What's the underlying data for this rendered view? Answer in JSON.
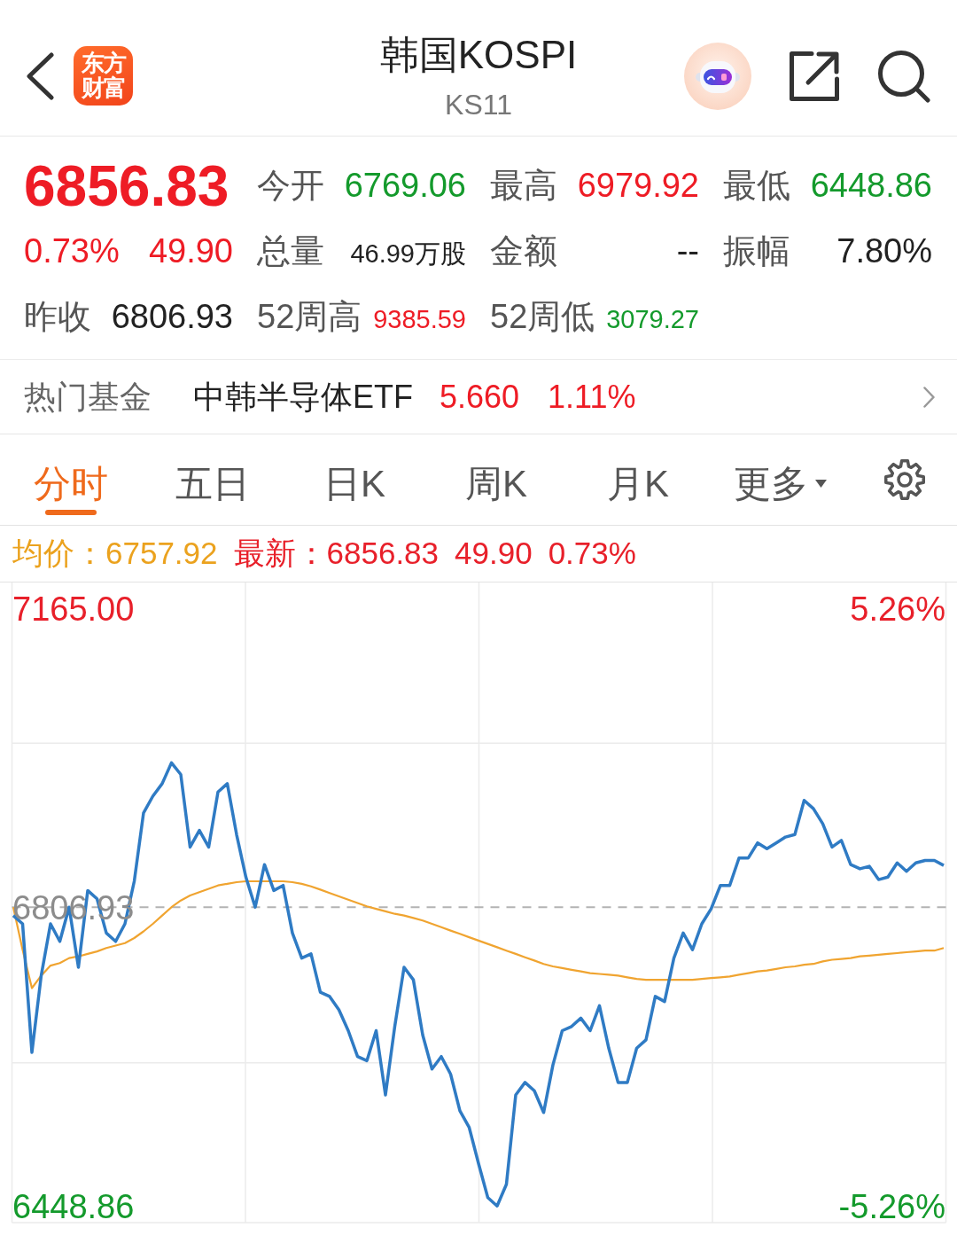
{
  "header": {
    "logo": [
      "东方",
      "财富"
    ],
    "title": "韩国KOSPI",
    "subtitle": "KS11"
  },
  "quote": {
    "price": "6856.83",
    "change_pct": "0.73%",
    "change": "49.90",
    "color": "#ee1c25",
    "prev_close_label": "昨收",
    "prev_close": "6806.93"
  },
  "stats": [
    {
      "name": "今开",
      "value": "6769.06",
      "color": "#149a2c",
      "kind": "regular"
    },
    {
      "name": "最高",
      "value": "6979.92",
      "color": "#ee1c25",
      "kind": "regular"
    },
    {
      "name": "最低",
      "value": "6448.86",
      "color": "#149a2c",
      "kind": "regular"
    },
    {
      "name": "总量",
      "value": "46.99万股",
      "color": "#222222",
      "kind": "compact"
    },
    {
      "name": "金额",
      "value": "--",
      "color": "#222222",
      "kind": "regular"
    },
    {
      "name": "振幅",
      "value": "7.80%",
      "color": "#222222",
      "kind": "regular"
    },
    {
      "name": "52周高",
      "value": "9385.59",
      "color": "#ee1c25",
      "kind": "compact"
    },
    {
      "name": "52周低",
      "value": "3079.27",
      "color": "#149a2c",
      "kind": "compact"
    }
  ],
  "hot_fund": {
    "label": "热门基金",
    "name": "中韩半导体ETF",
    "price": "5.660",
    "change": "1.11%",
    "color": "#ee1c25"
  },
  "tabs": [
    {
      "label": "分时",
      "selected": true,
      "dropdown": false
    },
    {
      "label": "五日",
      "selected": false,
      "dropdown": false
    },
    {
      "label": "日K",
      "selected": false,
      "dropdown": false
    },
    {
      "label": "周K",
      "selected": false,
      "dropdown": false
    },
    {
      "label": "月K",
      "selected": false,
      "dropdown": false
    },
    {
      "label": "更多",
      "selected": false,
      "dropdown": true
    }
  ],
  "info_line": [
    {
      "text": "均价：6757.92",
      "color": "#eba21e"
    },
    {
      "text": "最新：6856.83",
      "color": "#e8202a"
    },
    {
      "text": "49.90",
      "color": "#e8202a"
    },
    {
      "text": "0.73%",
      "color": "#e8202a"
    }
  ],
  "chart": {
    "chart_data": {
      "type": "line",
      "ylim": [
        6429,
        7195
      ],
      "yticks": [
        {
          "value": 7165.0,
          "label": "7165.00"
        },
        {
          "value": 6448.86,
          "label": "6448.86"
        }
      ],
      "ref_lines": [
        {
          "axis": "y",
          "value": 6806.93,
          "label": "6806.93"
        }
      ],
      "series": [
        {
          "color": "#2f7bc4",
          "values": [
            6797,
            6787,
            6633,
            6725,
            6787,
            6766,
            6807,
            6735,
            6827,
            6817,
            6776,
            6766,
            6787,
            6838,
            6920,
            6940,
            6955,
            6980,
            6966,
            6879,
            6899,
            6879,
            6945,
            6955,
            6894,
            6843,
            6807,
            6858,
            6827,
            6833,
            6776,
            6746,
            6751,
            6705,
            6700,
            6684,
            6659,
            6628,
            6623,
            6659,
            6582,
            6664,
            6735,
            6720,
            6654,
            6613,
            6628,
            6607,
            6563,
            6543,
            6500,
            6459,
            6449,
            6475,
            6582,
            6597,
            6587,
            6561,
            6618,
            6659,
            6664,
            6674,
            6659,
            6689,
            6638,
            6597,
            6597,
            6638,
            6648,
            6700,
            6694,
            6746,
            6776,
            6756,
            6787,
            6805,
            6833,
            6833,
            6866,
            6866,
            6884,
            6877,
            6884,
            6891,
            6894,
            6935,
            6925,
            6907,
            6879,
            6887,
            6858,
            6853,
            6856,
            6840,
            6843,
            6860,
            6850,
            6860,
            6863,
            6863,
            6857
          ]
        },
        {
          "color": "#f0a430",
          "values": [
            6807,
            6756,
            6710,
            6725,
            6737,
            6740,
            6746,
            6748,
            6751,
            6754,
            6758,
            6761,
            6764,
            6770,
            6778,
            6787,
            6797,
            6807,
            6815,
            6821,
            6825,
            6829,
            6833,
            6835,
            6837,
            6838,
            6838,
            6838,
            6838,
            6838,
            6837,
            6835,
            6832,
            6828,
            6824,
            6820,
            6816,
            6812,
            6808,
            6805,
            6802,
            6799,
            6797,
            6794,
            6791,
            6787,
            6783,
            6779,
            6775,
            6771,
            6767,
            6763,
            6759,
            6755,
            6751,
            6747,
            6743,
            6739,
            6736,
            6734,
            6732,
            6730,
            6728,
            6727,
            6726,
            6725,
            6723,
            6721,
            6720,
            6720,
            6720,
            6720,
            6720,
            6720,
            6721,
            6722,
            6723,
            6724,
            6726,
            6728,
            6730,
            6731,
            6733,
            6735,
            6736,
            6738,
            6739,
            6742,
            6744,
            6745,
            6746,
            6748,
            6749,
            6750,
            6751,
            6752,
            6753,
            6754,
            6755,
            6755,
            6758
          ]
        }
      ]
    },
    "right_labels": [
      "5.26%",
      "-5.26%"
    ]
  }
}
